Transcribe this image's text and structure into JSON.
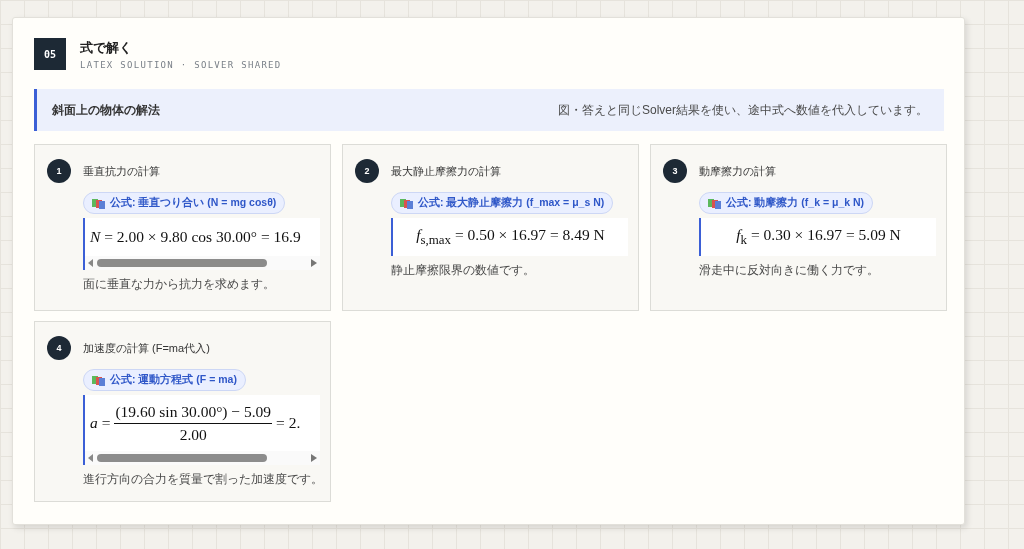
{
  "section": {
    "number": "05",
    "title": "式で解く",
    "subtitle": "LATEX SOLUTION · SOLVER SHARED"
  },
  "banner": {
    "title": "斜面上の物体の解法",
    "note": "図・答えと同じSolver結果を使い、途中式へ数値を代入しています。"
  },
  "steps": [
    {
      "number": "1",
      "title": "垂直抗力の計算",
      "formula": "公式: 垂直つり合い (N = mg cosθ)",
      "equation": {
        "kind": "inline",
        "text": "*N* = 2.00 × 9.80 cos 30.00° = 16.9"
      },
      "scrollable": true,
      "caption": "面に垂直な力から抗力を求めます。"
    },
    {
      "number": "2",
      "title": "最大静止摩擦力の計算",
      "formula": "公式: 最大静止摩擦力 (f_max = μ_s N)",
      "equation": {
        "kind": "inline",
        "text": "*f*$_{s,max}$ = 0.50 × 16.97 = 8.49 N"
      },
      "scrollable": false,
      "caption": "静止摩擦限界の数値です。"
    },
    {
      "number": "3",
      "title": "動摩擦力の計算",
      "formula": "公式: 動摩擦力 (f_k = μ_k N)",
      "equation": {
        "kind": "inline",
        "text": "*f*$_{k}$ = 0.30 × 16.97 = 5.09 N"
      },
      "scrollable": false,
      "caption": "滑走中に反対向きに働く力です。"
    },
    {
      "number": "4",
      "title": "加速度の計算 (F=ma代入)",
      "formula": "公式: 運動方程式 (F = ma)",
      "equation": {
        "kind": "fraction",
        "lhs": "*a* =",
        "numerator": "(19.60 sin 30.00°) − 5.09",
        "denominator": "2.00",
        "rhs": "= 2."
      },
      "scrollable": true,
      "caption": "進行方向の合力を質量で割った加速度です。"
    }
  ]
}
